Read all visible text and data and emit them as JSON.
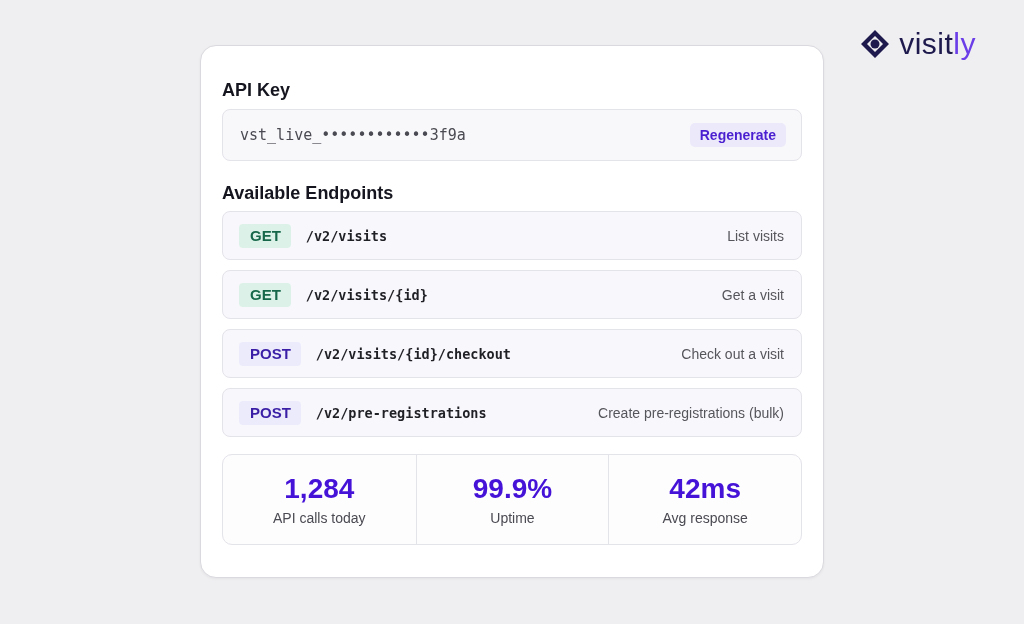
{
  "logo": {
    "name": "visit",
    "accent": "ly"
  },
  "api_key": {
    "title": "API Key",
    "value": "vst_live_••••••••••••3f9a",
    "button": "Regenerate"
  },
  "endpoints": {
    "title": "Available Endpoints",
    "items": [
      {
        "method": "GET",
        "kind": "get",
        "path": "/v2/visits",
        "description": "List visits"
      },
      {
        "method": "GET",
        "kind": "get",
        "path": "/v2/visits/{id}",
        "description": "Get a visit"
      },
      {
        "method": "POST",
        "kind": "post",
        "path": "/v2/visits/{id}/checkout",
        "description": "Check out a visit"
      },
      {
        "method": "POST",
        "kind": "post",
        "path": "/v2/pre-registrations",
        "description": "Create pre-registrations (bulk)"
      }
    ]
  },
  "stats": [
    {
      "value": "1,284",
      "label": "API calls today"
    },
    {
      "value": "99.9%",
      "label": "Uptime"
    },
    {
      "value": "42ms",
      "label": "Avg response"
    }
  ]
}
